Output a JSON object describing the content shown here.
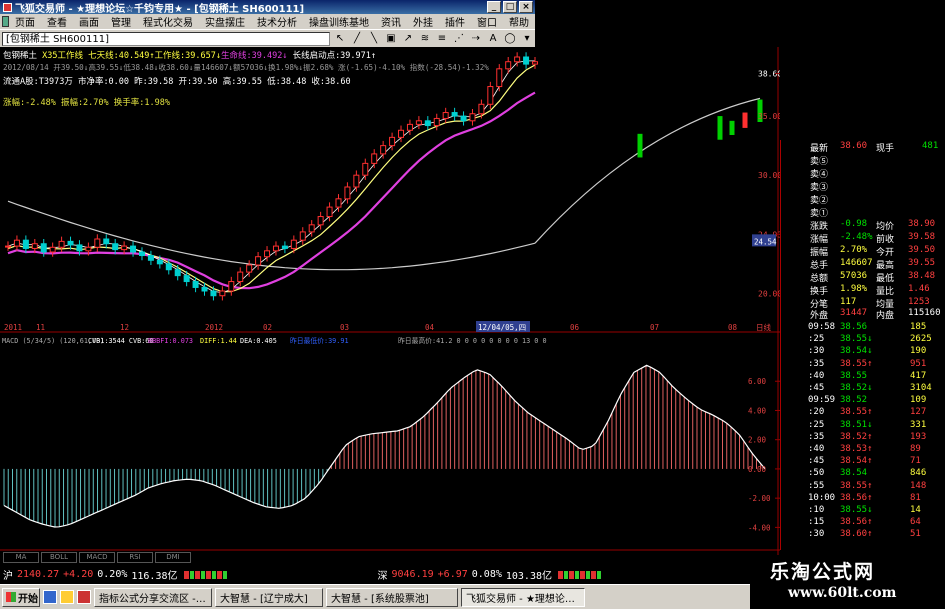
{
  "window": {
    "title": "飞狐交易师 - ★理想论坛☆千钧专用★ - [包钢稀土 SH600111]"
  },
  "menu": [
    "页面",
    "查看",
    "画面",
    "管理",
    "程式化交易",
    "实盘摆庄",
    "技术分析",
    "操盘训练基地",
    "资讯",
    "外挂",
    "插件",
    "窗口",
    "帮助"
  ],
  "toolbar": {
    "title": "[包钢稀土 SH600111]"
  },
  "header": {
    "line1": "包钢稀土 ",
    "line1b": "X35工作线 七天线:40.549↑工作线:39.657↓",
    "line1c": "生命线:39.492↓",
    "line1d": "长线启动点:39.971↑",
    "line2": "2012/08/14 开39.50↓高39.55↓低38.48↓收38.60↓量146607↓额57036↓换1.98%↓振2.68% 涨(-1.65)-4.10% 指数(-28.54)-1.32%",
    "line3": "流通A股:T3973万 市净率:0.00 昨:39.58 开:39.50 高:39.55 低:38.48 收:38.60",
    "line4": "涨幅:-2.48% 振幅:2.70% 换手率:1.98%"
  },
  "xaxis": [
    "2011",
    "11",
    "12",
    "2012",
    "02",
    "03",
    "04",
    "12/04/05,四",
    "06",
    "07",
    "08",
    "日线"
  ],
  "main_yaxis": [
    "38.60",
    "35.00",
    "30.00",
    "24.93",
    "20.00"
  ],
  "price_tag": "24.54",
  "macd_header": {
    "a": "MACD (5/34/5) (120,61,60)",
    "b": "CVB1:3544 CVB:60",
    "c": "BBBFI:0.073",
    "d": "DIFF:1.44",
    "e": "DEA:0.405",
    "f": "昨日最低价:39.91",
    "g": "昨日最高价:41.2 0 0 0 0 0 0 0 0 13 0 0"
  },
  "macd_yaxis": [
    "6.00",
    "4.00",
    "2.00",
    "0.00",
    "-2.00",
    "-4.00"
  ],
  "bottom_tabs": [
    "MA",
    "BOLL",
    "MACD",
    "RSI",
    "DMI"
  ],
  "chart_data": {
    "type": "candlestick+macd",
    "ylim": [
      18,
      40
    ],
    "macd_ylim": [
      -5,
      8
    ],
    "price": [
      24,
      24.5,
      23.8,
      24.2,
      23.5,
      23.9,
      24.4,
      24.1,
      23.6,
      23.9,
      24.6,
      24.2,
      23.7,
      24,
      23.5,
      23.2,
      22.8,
      22.5,
      22,
      21.5,
      21,
      20.5,
      20.2,
      19.8,
      20.2,
      21,
      21.8,
      22.4,
      23.1,
      23.6,
      24,
      23.8,
      24.5,
      25.2,
      25.8,
      26.5,
      27.3,
      28,
      29,
      30,
      31,
      31.8,
      32.5,
      33.2,
      33.8,
      34.3,
      34.6,
      34.2,
      34.8,
      35.3,
      35,
      34.6,
      35.2,
      36,
      37.5,
      39,
      39.6,
      40,
      39.4,
      39.6
    ],
    "macd": [
      -2.5,
      -3,
      -3.5,
      -3.8,
      -4,
      -3.8,
      -3.4,
      -3,
      -2.6,
      -2.2,
      -1.8,
      -1.3,
      -1,
      -0.8,
      -0.7,
      -0.8,
      -1.1,
      -1.5,
      -1.9,
      -2.3,
      -2.6,
      -2.7,
      -2.5,
      -2,
      -1,
      0.3,
      1.6,
      2.2,
      2.4,
      2.5,
      2.6,
      2.9,
      3.6,
      4.5,
      5.5,
      6.2,
      6.8,
      6.5,
      5.6,
      4.6,
      3.8,
      3.2,
      2.6,
      2,
      1.3,
      1.6,
      3.2,
      5.1,
      6.6,
      7.1,
      6.6,
      5.6,
      4.8,
      4.1,
      3.7,
      3.2,
      2.4,
      1.1,
      0
    ]
  },
  "quote": {
    "latest": {
      "label": "最新",
      "value": "38.60",
      "bid": "现手",
      "bid_v": "481"
    },
    "buys": [
      "卖⑤",
      "卖④",
      "卖③",
      "卖②",
      "卖①"
    ],
    "rows": [
      {
        "l1": "涨跌",
        "v1": "-0.98",
        "l2": "均价",
        "v2": "38.90"
      },
      {
        "l1": "涨幅",
        "v1": "-2.48%",
        "l2": "前收",
        "v2": "39.58"
      },
      {
        "l1": "振幅",
        "v1": "2.70%",
        "l2": "今开",
        "v2": "39.50"
      },
      {
        "l1": "总手",
        "v1": "146607",
        "l2": "最高",
        "v2": "39.55"
      },
      {
        "l1": "总额",
        "v1": "57036",
        "l2": "最低",
        "v2": "38.48"
      },
      {
        "l1": "换手",
        "v1": "1.98%",
        "l2": "量比",
        "v2": "1.46"
      },
      {
        "l1": "分笔",
        "v1": "117",
        "l2": "均量",
        "v2": "1253"
      }
    ],
    "waipan": {
      "label": "外盘",
      "v": "31447",
      "label2": "内盘",
      "v2": "115160"
    },
    "ticks": [
      {
        "t": "09:58",
        "p": "38.56",
        "v": "185"
      },
      {
        "t": ":25",
        "p": "38.55↓",
        "v": "2625"
      },
      {
        "t": ":30",
        "p": "38.54↓",
        "v": "190"
      },
      {
        "t": ":35",
        "p": "38.55↑",
        "v": "951"
      },
      {
        "t": ":40",
        "p": "38.55",
        "v": "417"
      },
      {
        "t": ":45",
        "p": "38.52↓",
        "v": "3104"
      },
      {
        "t": "09:59",
        "p": "38.52",
        "v": "109"
      },
      {
        "t": ":20",
        "p": "38.55↑",
        "v": "127"
      },
      {
        "t": ":25",
        "p": "38.51↓",
        "v": "331"
      },
      {
        "t": ":35",
        "p": "38.52↑",
        "v": "193"
      },
      {
        "t": ":40",
        "p": "38.53↑",
        "v": "89"
      },
      {
        "t": ":45",
        "p": "38.54↑",
        "v": "71"
      },
      {
        "t": ":50",
        "p": "38.54",
        "v": "846"
      },
      {
        "t": ":55",
        "p": "38.55↑",
        "v": "148"
      },
      {
        "t": "10:00",
        "p": "38.56↑",
        "v": "81"
      },
      {
        "t": ":10",
        "p": "38.55↓",
        "v": "14"
      },
      {
        "t": ":15",
        "p": "38.56↑",
        "v": "64"
      },
      {
        "t": ":30",
        "p": "38.60↑",
        "v": "51"
      }
    ]
  },
  "status": {
    "sh_label": "沪",
    "sh": "2140.27",
    "sh_ch": "+4.20",
    "sh_pct": "0.20%",
    "sh_amt": "116.38亿",
    "sz_label": "深",
    "sz": "9046.19",
    "sz_ch": "+6.97",
    "sz_pct": "0.08%",
    "sz_amt": "103.38亿"
  },
  "taskbar": {
    "start": "开始",
    "tasks": [
      "指标公式分享交流区 -…",
      "大智慧 - [辽宁成大]",
      "大智慧 - [系统股票池]",
      "飞狐交易师 - ★理想论…"
    ]
  },
  "watermark": {
    "cn": "乐淘公式网",
    "url": "www.60lt.com"
  }
}
